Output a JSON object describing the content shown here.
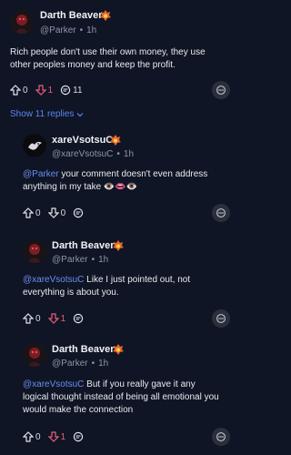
{
  "posts": [
    {
      "author": "Darth Beaver",
      "handle": "@Parker",
      "time": "1h",
      "text": "Rich people don't use their own money, they use other peoples money and keep the profit.",
      "mention": "",
      "upvotes": "0",
      "downvotes": "1",
      "comments": "11",
      "avatar_icon": "dark-figure-avatar",
      "badge_icon": "flame-badge-icon"
    },
    {
      "author": "xareVsotsuC",
      "handle": "@xareVsotsuC",
      "time": "1h",
      "mention": "@Parker",
      "text": " your comment doesn't even address anything in my take 👁️👄👁️",
      "upvotes": "0",
      "downvotes": "0",
      "comments": "",
      "avatar_icon": "bird-avatar",
      "badge_icon": "flame-badge-icon"
    },
    {
      "author": "Darth Beaver",
      "handle": "@Parker",
      "time": "1h",
      "mention": "@xareVsotsuC",
      "text": " Like I just pointed out, not everything is about you.",
      "upvotes": "0",
      "downvotes": "1",
      "comments": "",
      "avatar_icon": "dark-figure-avatar",
      "badge_icon": "flame-badge-icon"
    },
    {
      "author": "Darth Beaver",
      "handle": "@Parker",
      "time": "1h",
      "mention": "@xareVsotsuC",
      "text": " But if you really gave it any logical thought instead of being all emotional you would make the connection",
      "upvotes": "0",
      "downvotes": "1",
      "comments": "",
      "avatar_icon": "dark-figure-avatar",
      "badge_icon": "flame-badge-icon"
    }
  ],
  "show_replies_label": "Show 11 replies",
  "colors": {
    "background": "#0f1525",
    "mention": "#6b8df0",
    "downvote_active": "#ea5d7a",
    "link": "#5b86f0"
  }
}
